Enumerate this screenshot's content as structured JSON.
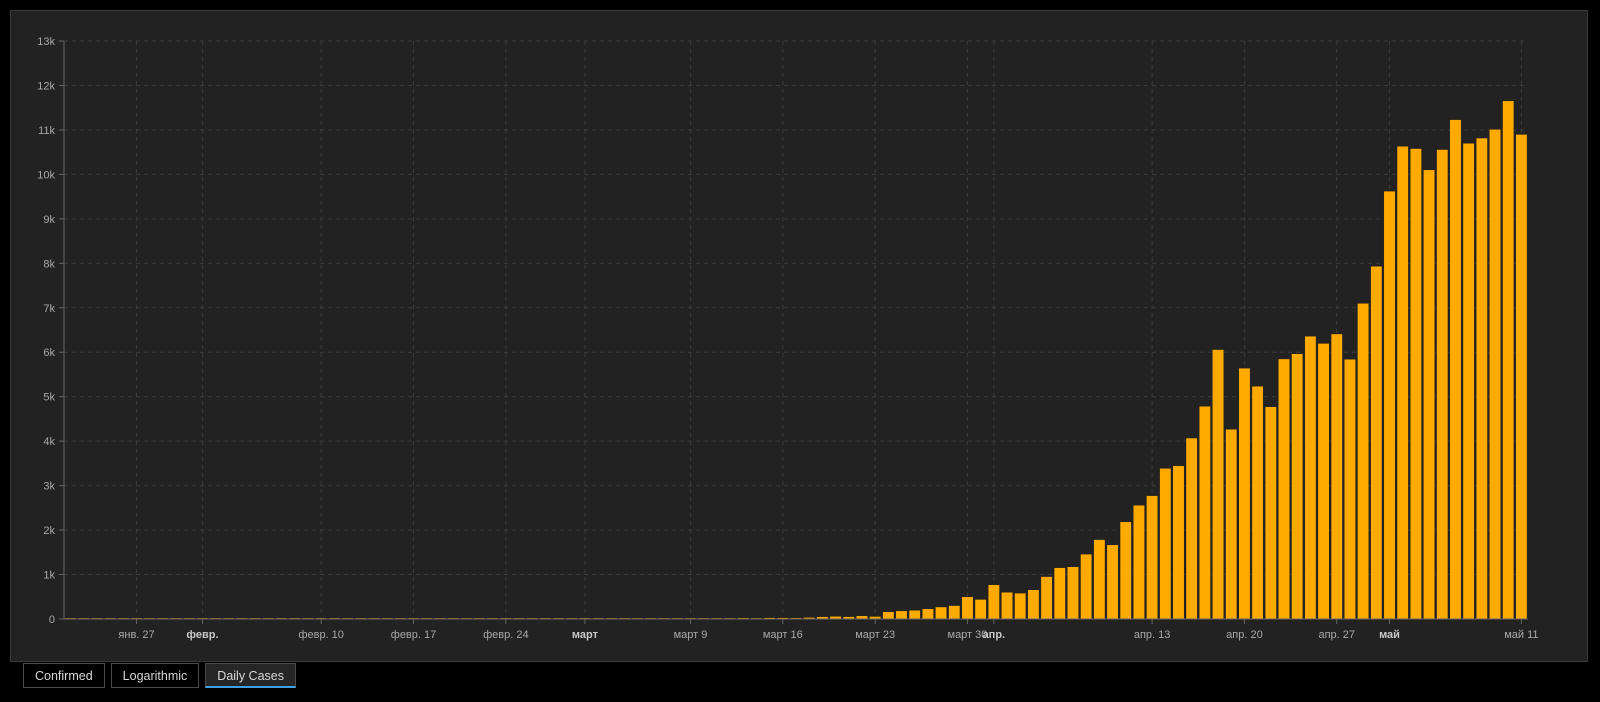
{
  "tabs": [
    {
      "label": "Confirmed",
      "active": false
    },
    {
      "label": "Logarithmic",
      "active": false
    },
    {
      "label": "Daily Cases",
      "active": true
    }
  ],
  "chart_data": {
    "type": "bar",
    "ylim": [
      0,
      13000
    ],
    "y_ticks": [
      {
        "value": 0,
        "label": "0"
      },
      {
        "value": 1000,
        "label": "1k"
      },
      {
        "value": 2000,
        "label": "2k"
      },
      {
        "value": 3000,
        "label": "3k"
      },
      {
        "value": 4000,
        "label": "4k"
      },
      {
        "value": 5000,
        "label": "5k"
      },
      {
        "value": 6000,
        "label": "6k"
      },
      {
        "value": 7000,
        "label": "7k"
      },
      {
        "value": 8000,
        "label": "8k"
      },
      {
        "value": 9000,
        "label": "9k"
      },
      {
        "value": 10000,
        "label": "10k"
      },
      {
        "value": 11000,
        "label": "11k"
      },
      {
        "value": 12000,
        "label": "12k"
      },
      {
        "value": 13000,
        "label": "13k"
      }
    ],
    "x_ticks": [
      {
        "date": "2020-01-27",
        "label": "янв. 27",
        "bold": false
      },
      {
        "date": "2020-02-01",
        "label": "февр.",
        "bold": true
      },
      {
        "date": "2020-02-10",
        "label": "февр. 10",
        "bold": false
      },
      {
        "date": "2020-02-17",
        "label": "февр. 17",
        "bold": false
      },
      {
        "date": "2020-02-24",
        "label": "февр. 24",
        "bold": false
      },
      {
        "date": "2020-03-01",
        "label": "март",
        "bold": true
      },
      {
        "date": "2020-03-09",
        "label": "март 9",
        "bold": false
      },
      {
        "date": "2020-03-16",
        "label": "март 16",
        "bold": false
      },
      {
        "date": "2020-03-23",
        "label": "март 23",
        "bold": false
      },
      {
        "date": "2020-03-30",
        "label": "март 30",
        "bold": false
      },
      {
        "date": "2020-04-01",
        "label": "апр.",
        "bold": true
      },
      {
        "date": "2020-04-13",
        "label": "апр. 13",
        "bold": false
      },
      {
        "date": "2020-04-20",
        "label": "апр. 20",
        "bold": false
      },
      {
        "date": "2020-04-27",
        "label": "апр. 27",
        "bold": false
      },
      {
        "date": "2020-05-01",
        "label": "май",
        "bold": true
      },
      {
        "date": "2020-05-11",
        "label": "май 11",
        "bold": false
      }
    ],
    "grid": true,
    "bar_color": "#FFAA00",
    "x": [
      "2020-01-22",
      "2020-01-23",
      "2020-01-24",
      "2020-01-25",
      "2020-01-26",
      "2020-01-27",
      "2020-01-28",
      "2020-01-29",
      "2020-01-30",
      "2020-01-31",
      "2020-02-01",
      "2020-02-02",
      "2020-02-03",
      "2020-02-04",
      "2020-02-05",
      "2020-02-06",
      "2020-02-07",
      "2020-02-08",
      "2020-02-09",
      "2020-02-10",
      "2020-02-11",
      "2020-02-12",
      "2020-02-13",
      "2020-02-14",
      "2020-02-15",
      "2020-02-16",
      "2020-02-17",
      "2020-02-18",
      "2020-02-19",
      "2020-02-20",
      "2020-02-21",
      "2020-02-22",
      "2020-02-23",
      "2020-02-24",
      "2020-02-25",
      "2020-02-26",
      "2020-02-27",
      "2020-02-28",
      "2020-02-29",
      "2020-03-01",
      "2020-03-02",
      "2020-03-03",
      "2020-03-04",
      "2020-03-05",
      "2020-03-06",
      "2020-03-07",
      "2020-03-08",
      "2020-03-09",
      "2020-03-10",
      "2020-03-11",
      "2020-03-12",
      "2020-03-13",
      "2020-03-14",
      "2020-03-15",
      "2020-03-16",
      "2020-03-17",
      "2020-03-18",
      "2020-03-19",
      "2020-03-20",
      "2020-03-21",
      "2020-03-22",
      "2020-03-23",
      "2020-03-24",
      "2020-03-25",
      "2020-03-26",
      "2020-03-27",
      "2020-03-28",
      "2020-03-29",
      "2020-03-30",
      "2020-03-31",
      "2020-04-01",
      "2020-04-02",
      "2020-04-03",
      "2020-04-04",
      "2020-04-05",
      "2020-04-06",
      "2020-04-07",
      "2020-04-08",
      "2020-04-09",
      "2020-04-10",
      "2020-04-11",
      "2020-04-12",
      "2020-04-13",
      "2020-04-14",
      "2020-04-15",
      "2020-04-16",
      "2020-04-17",
      "2020-04-18",
      "2020-04-19",
      "2020-04-20",
      "2020-04-21",
      "2020-04-22",
      "2020-04-23",
      "2020-04-24",
      "2020-04-25",
      "2020-04-26",
      "2020-04-27",
      "2020-04-28",
      "2020-04-29",
      "2020-04-30",
      "2020-05-01",
      "2020-05-02",
      "2020-05-03",
      "2020-05-04",
      "2020-05-05",
      "2020-05-06",
      "2020-05-07",
      "2020-05-08",
      "2020-05-09",
      "2020-05-10",
      "2020-05-11"
    ],
    "values": [
      0,
      0,
      0,
      0,
      0,
      0,
      0,
      0,
      0,
      2,
      0,
      0,
      0,
      0,
      0,
      0,
      0,
      0,
      0,
      0,
      0,
      0,
      0,
      0,
      0,
      0,
      0,
      0,
      0,
      0,
      0,
      0,
      0,
      0,
      0,
      0,
      0,
      0,
      0,
      0,
      0,
      0,
      0,
      1,
      0,
      0,
      0,
      0,
      3,
      8,
      6,
      25,
      20,
      30,
      30,
      25,
      35,
      52,
      59,
      53,
      71,
      57,
      163,
      182,
      196,
      228,
      270,
      302,
      500,
      440,
      771,
      601,
      582,
      658,
      954,
      1154,
      1175,
      1459,
      1786,
      1667,
      2186,
      2558,
      2774,
      3388,
      3448,
      4070,
      4785,
      6060,
      4268,
      5642,
      5236,
      4774,
      5849,
      5966,
      6361,
      6198,
      6411,
      5841,
      7099,
      7933,
      9623,
      10633,
      10581,
      10102,
      10559,
      11231,
      10699,
      10817,
      11012,
      11656,
      10899
    ]
  }
}
